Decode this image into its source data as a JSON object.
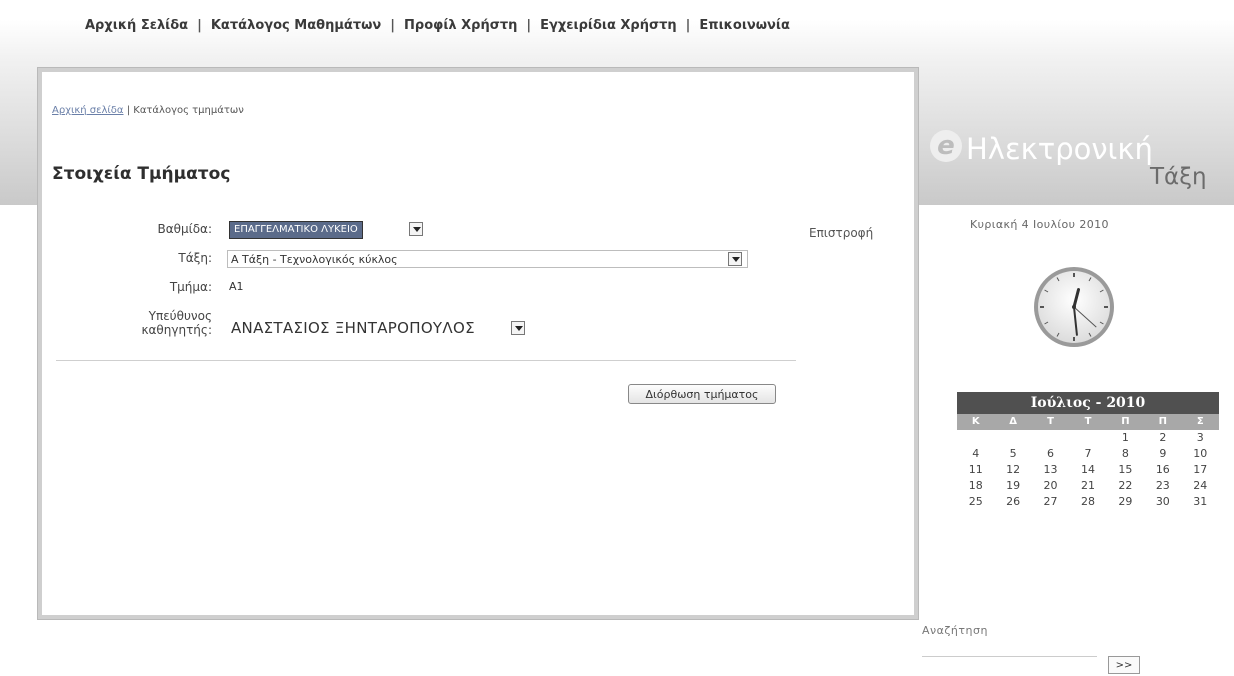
{
  "nav": {
    "items": [
      "Αρχική Σελίδα",
      "Κατάλογος Μαθημάτων",
      "Προφίλ Χρήστη",
      "Εγχειρίδια Χρήστη",
      "Επικοινωνία"
    ],
    "separator": "|"
  },
  "breadcrumb": {
    "home": "Αρχική σελίδα",
    "separator": "|",
    "current": "Κατάλογος τμημάτων"
  },
  "page_title": "Στοιχεία Τμήματος",
  "form": {
    "level_label": "Βαθμίδα:",
    "level_value": "ΕΠΑΓΓΕΛΜΑΤΙΚΟ ΛΥΚΕΙΟ",
    "class_label": "Τάξη:",
    "class_value": "Α Τάξη - Τεχνολογικός κύκλος",
    "section_label": "Τμήμα:",
    "section_value": "Α1",
    "teacher_label_1": "Υπεύθυνος",
    "teacher_label_2": "καθηγητής:",
    "teacher_value": "ΑΝΑΣΤΑΣΙΟΣ ΞΗΝΤΑΡΟΠΟΥΛΟΣ",
    "submit": "Διόρθωση τμήματος",
    "back": "Επιστροφή"
  },
  "logo": {
    "line1": "Ηλεκτρονική",
    "line2": "Τάξη",
    "mark": "e"
  },
  "date": "Κυριακή 4 Ιουλίου 2010",
  "calendar": {
    "title": "Ιούλιος - 2010",
    "days": [
      "Κ",
      "Δ",
      "Τ",
      "Τ",
      "Π",
      "Π",
      "Σ"
    ],
    "weeks": [
      [
        "",
        "",
        "",
        "",
        "1",
        "2",
        "3"
      ],
      [
        "4",
        "5",
        "6",
        "7",
        "8",
        "9",
        "10"
      ],
      [
        "11",
        "12",
        "13",
        "14",
        "15",
        "16",
        "17"
      ],
      [
        "18",
        "19",
        "20",
        "21",
        "22",
        "23",
        "24"
      ],
      [
        "25",
        "26",
        "27",
        "28",
        "29",
        "30",
        "31"
      ]
    ]
  },
  "search": {
    "label": "Αναζήτηση",
    "button": ">>"
  },
  "clock": {
    "hour": 12,
    "minute": 29,
    "second": 22
  },
  "colors": {
    "calendar_header": "#505050",
    "calendar_days": "#a8a8a8",
    "selection": "#5b6b8a"
  }
}
